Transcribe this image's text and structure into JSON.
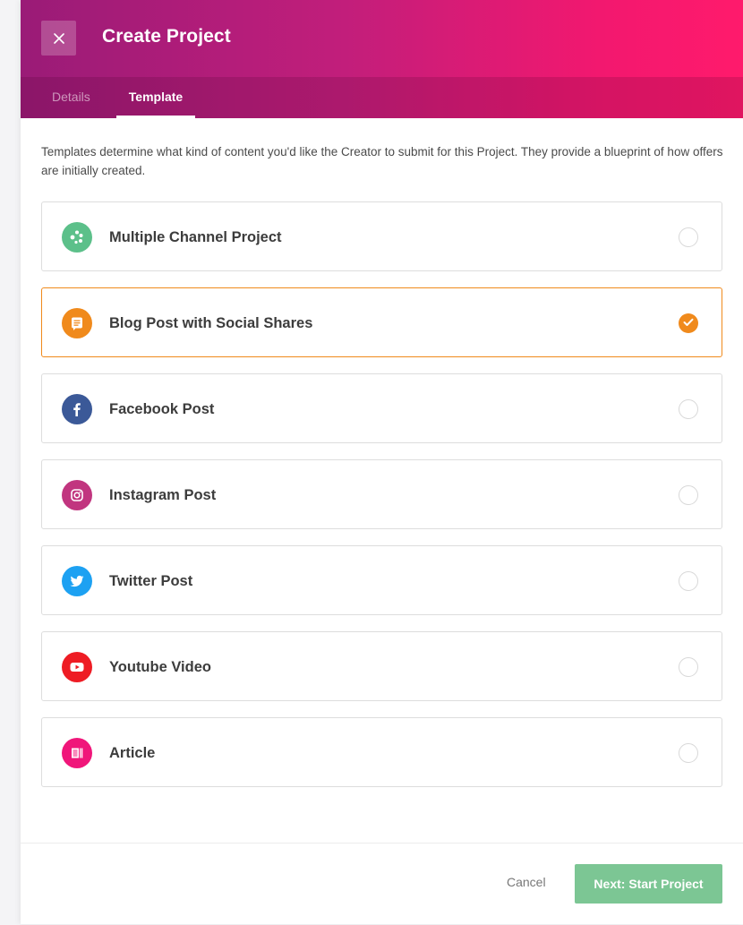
{
  "header": {
    "title": "Create Project",
    "close_icon": "close-icon"
  },
  "tabs": [
    {
      "label": "Details",
      "active": false
    },
    {
      "label": "Template",
      "active": true
    }
  ],
  "description": "Templates determine what kind of content you'd like the Creator to submit for this Project. They provide a blueprint of how offers are initially created.",
  "templates": [
    {
      "label": "Multiple Channel Project",
      "icon": "multi-channel-icon",
      "color": "#5cc08a",
      "selected": false
    },
    {
      "label": "Blog Post with Social Shares",
      "icon": "blog-post-icon",
      "color": "#f08a1c",
      "selected": true
    },
    {
      "label": "Facebook Post",
      "icon": "facebook-icon",
      "color": "#3b5998",
      "selected": false
    },
    {
      "label": "Instagram Post",
      "icon": "instagram-icon",
      "color": "#c1357f",
      "selected": false
    },
    {
      "label": "Twitter Post",
      "icon": "twitter-icon",
      "color": "#1da1f2",
      "selected": false
    },
    {
      "label": "Youtube Video",
      "icon": "youtube-icon",
      "color": "#ee1c24",
      "selected": false
    },
    {
      "label": "Article",
      "icon": "article-icon",
      "color": "#f0167a",
      "selected": false
    }
  ],
  "footer": {
    "cancel_label": "Cancel",
    "next_label": "Next: Start Project"
  },
  "colors": {
    "accent_selected": "#f08a1c",
    "primary_button": "#7cc694",
    "header_gradient_start": "#9a1b77",
    "header_gradient_end": "#ff1a6c"
  }
}
